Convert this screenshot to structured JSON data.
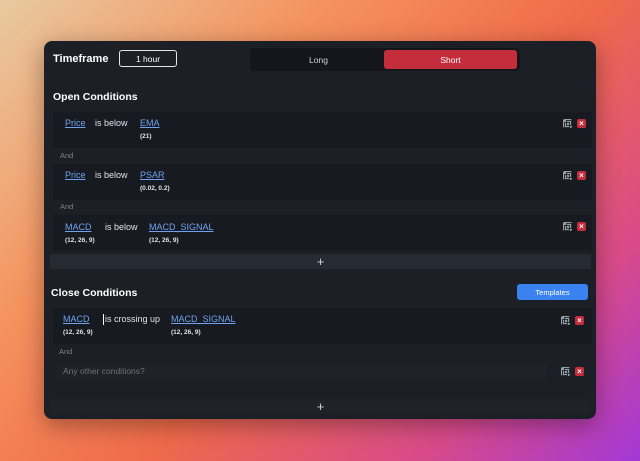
{
  "timeframe": {
    "label": "Timeframe",
    "value": "1 hour"
  },
  "direction": {
    "options": [
      "Long",
      "Short"
    ],
    "selected": "Short"
  },
  "open_conditions": {
    "title": "Open Conditions",
    "and_label": "And",
    "rows": [
      {
        "lhs": "Price",
        "lhs_params": "",
        "op": "is below",
        "rhs": "EMA",
        "rhs_params": "(21)"
      },
      {
        "lhs": "Price",
        "lhs_params": "",
        "op": "is below",
        "rhs": "PSAR",
        "rhs_params": "(0.02, 0.2)"
      },
      {
        "lhs": "MACD",
        "lhs_params": "(12, 26, 9)",
        "op": "is below",
        "rhs": "MACD_SIGNAL",
        "rhs_params": "(12, 26, 9)"
      }
    ],
    "add_symbol": "+"
  },
  "close_conditions": {
    "title": "Close Conditions",
    "templates_label": "Templates",
    "and_label": "And",
    "rows": [
      {
        "lhs": "MACD",
        "lhs_params": "(12, 26, 9)",
        "op": "is crossing up",
        "rhs": "MACD_SIGNAL",
        "rhs_params": "(12, 26, 9)"
      }
    ],
    "input_placeholder": "Any other conditions?",
    "add_symbol": "+"
  },
  "icons": {
    "copy": "copy-icon",
    "delete": "close-icon"
  },
  "colors": {
    "accent": "#3a82f0",
    "danger": "#c42e3c",
    "link": "#6fa3f0",
    "panel": "#1c1f26"
  }
}
